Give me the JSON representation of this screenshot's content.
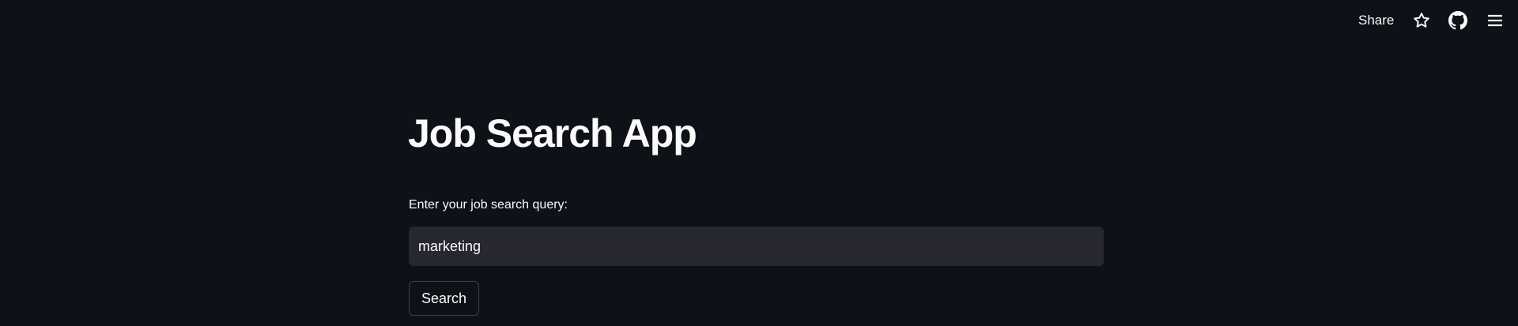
{
  "header": {
    "share_label": "Share",
    "icons": [
      "star-icon",
      "github-icon",
      "hamburger-menu-icon"
    ]
  },
  "main": {
    "title": "Job Search App",
    "query_label": "Enter your job search query:",
    "query_value": "marketing",
    "search_button": "Search"
  },
  "colors": {
    "background": "#0e1117",
    "input_background": "#262730",
    "text": "#fafafa"
  }
}
